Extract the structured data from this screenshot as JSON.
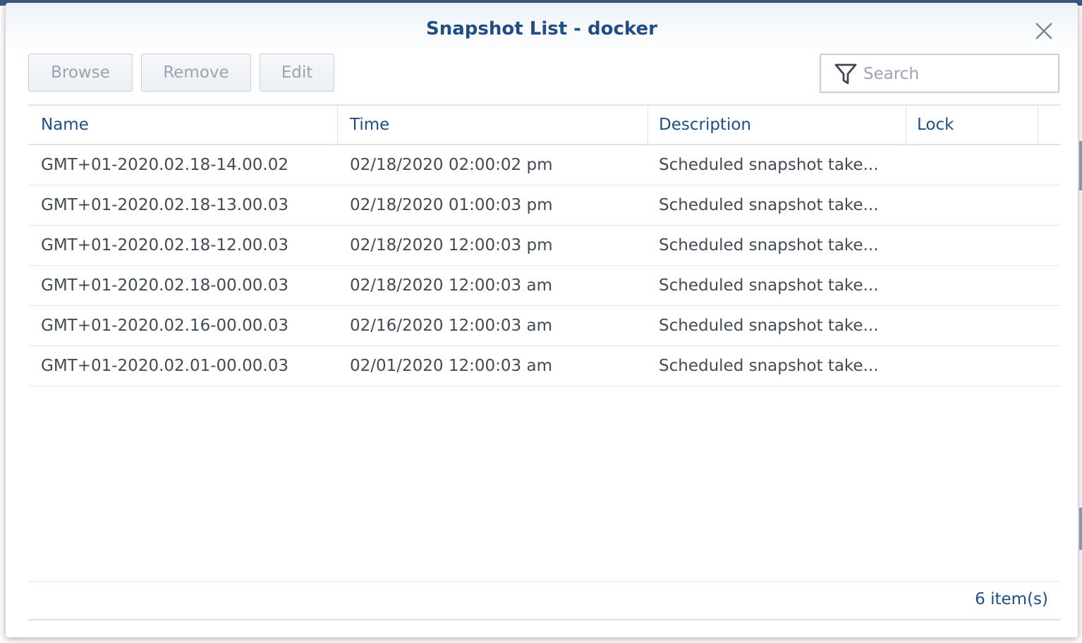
{
  "dialog": {
    "title": "Snapshot List - docker"
  },
  "toolbar": {
    "browse_label": "Browse",
    "remove_label": "Remove",
    "edit_label": "Edit"
  },
  "search": {
    "placeholder": "Search",
    "value": ""
  },
  "table": {
    "columns": [
      "Name",
      "Time",
      "Description",
      "Lock"
    ],
    "rows": [
      {
        "name": "GMT+01-2020.02.18-14.00.02",
        "time": "02/18/2020 02:00:02 pm",
        "description": "Scheduled snapshot take...",
        "lock": ""
      },
      {
        "name": "GMT+01-2020.02.18-13.00.03",
        "time": "02/18/2020 01:00:03 pm",
        "description": "Scheduled snapshot take...",
        "lock": ""
      },
      {
        "name": "GMT+01-2020.02.18-12.00.03",
        "time": "02/18/2020 12:00:03 pm",
        "description": "Scheduled snapshot take...",
        "lock": ""
      },
      {
        "name": "GMT+01-2020.02.18-00.00.03",
        "time": "02/18/2020 12:00:03 am",
        "description": "Scheduled snapshot take...",
        "lock": ""
      },
      {
        "name": "GMT+01-2020.02.16-00.00.03",
        "time": "02/16/2020 12:00:03 am",
        "description": "Scheduled snapshot take...",
        "lock": ""
      },
      {
        "name": "GMT+01-2020.02.01-00.00.03",
        "time": "02/01/2020 12:00:03 am",
        "description": "Scheduled snapshot take...",
        "lock": ""
      }
    ]
  },
  "footer": {
    "item_count": "6 item(s)"
  },
  "colors": {
    "accent": "#1f4e85",
    "disabled_text": "#9aa4b1"
  },
  "icons": {
    "close": "close-icon",
    "filter": "filter-icon"
  }
}
